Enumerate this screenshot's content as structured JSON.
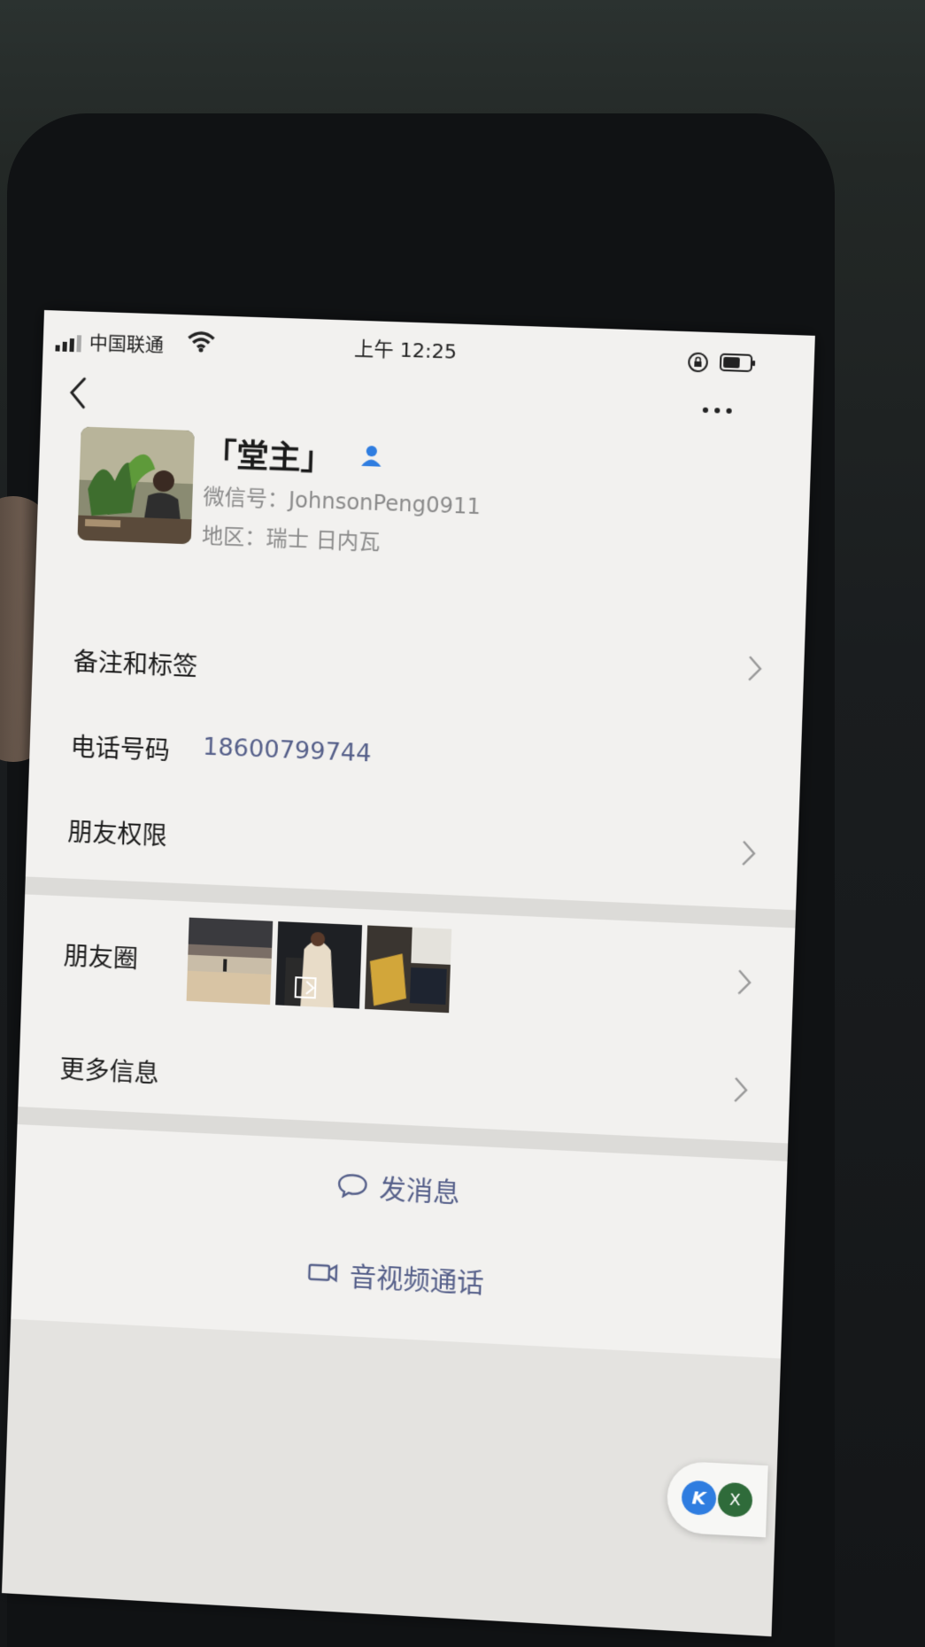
{
  "status_bar": {
    "carrier": "中国联通",
    "time": "上午 12:25"
  },
  "profile": {
    "name": "「堂主」",
    "wechat_id": "微信号：JohnsonPeng0911",
    "region": "地区：瑞士 日内瓦"
  },
  "rows": {
    "remarks_label": "备注和标签",
    "phone_label": "电话号码",
    "phone_value": "18600799744",
    "friend_perm_label": "朋友权限",
    "moments_label": "朋友圈",
    "more_info_label": "更多信息"
  },
  "actions": {
    "send_message": "发消息",
    "av_call": "音视频通话"
  },
  "widget": {
    "k_label": "K",
    "x_label": "X"
  },
  "colors": {
    "link_blue": "#56608a",
    "verify_blue": "#2f7de0",
    "screen_bg": "#f2f1ef"
  }
}
